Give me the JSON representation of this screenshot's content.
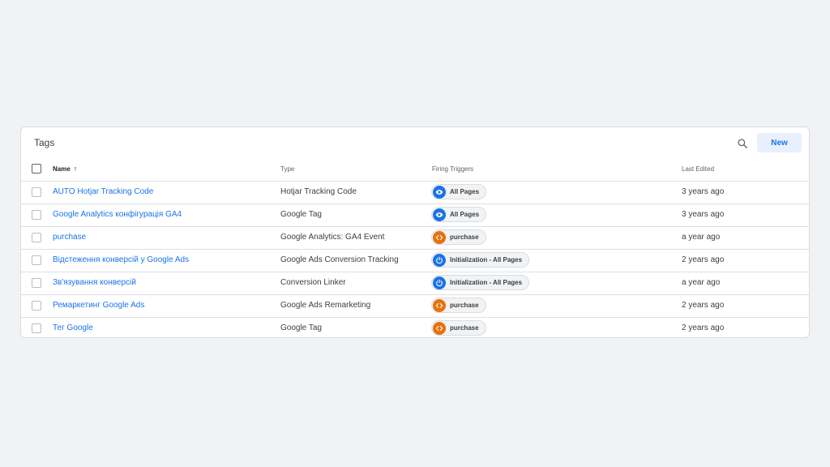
{
  "card": {
    "title": "Tags",
    "new_label": "New",
    "search_icon": "search-icon"
  },
  "columns": {
    "name": "Name",
    "type": "Type",
    "triggers": "Firing Triggers",
    "edited": "Last Edited"
  },
  "colors": {
    "link": "#1a73e8",
    "trigger_pageview": "#1a73e8",
    "trigger_custom": "#e8710a",
    "trigger_init": "#1a73e8"
  },
  "rows": [
    {
      "name": "AUTO Hotjar Tracking Code",
      "type": "Hotjar Tracking Code",
      "trigger": "All Pages",
      "trigger_icon": "eye-icon",
      "edited": "3 years ago"
    },
    {
      "name": "Google Analytics конфігурація GA4",
      "type": "Google Tag",
      "trigger": "All Pages",
      "trigger_icon": "eye-icon",
      "edited": "3 years ago"
    },
    {
      "name": "purchase",
      "type": "Google Analytics: GA4 Event",
      "trigger": "purchase",
      "trigger_icon": "code-icon",
      "edited": "a year ago"
    },
    {
      "name": "Відстеження конверсій у Google Ads",
      "type": "Google Ads Conversion Tracking",
      "trigger": "Initialization - All Pages",
      "trigger_icon": "power-icon",
      "edited": "2 years ago"
    },
    {
      "name": "Зв'язування конверсій",
      "type": "Conversion Linker",
      "trigger": "Initialization - All Pages",
      "trigger_icon": "power-icon",
      "edited": "a year ago"
    },
    {
      "name": "Ремаркетинг Google Ads",
      "type": "Google Ads Remarketing",
      "trigger": "purchase",
      "trigger_icon": "code-icon",
      "edited": "2 years ago"
    },
    {
      "name": "Тег Google",
      "type": "Google Tag",
      "trigger": "purchase",
      "trigger_icon": "code-icon",
      "edited": "2 years ago"
    }
  ]
}
